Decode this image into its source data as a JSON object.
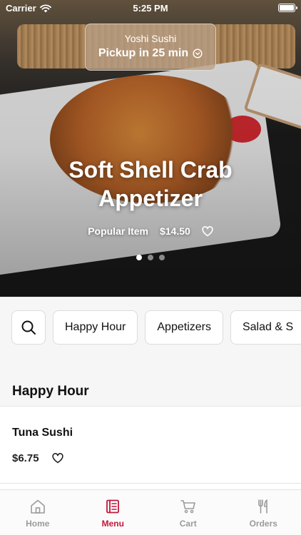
{
  "status_bar": {
    "carrier": "Carrier",
    "time": "5:25 PM"
  },
  "pickup": {
    "store_name": "Yoshi Sushi",
    "eta": "Pickup in 25 min"
  },
  "hero": {
    "title_line1": "Soft Shell Crab",
    "title_line2": "Appetizer",
    "badge": "Popular Item",
    "price": "$14.50",
    "slides_total": 3,
    "active_slide": 1
  },
  "categories": {
    "chips": [
      "Happy Hour",
      "Appetizers",
      "Salad & S"
    ]
  },
  "section": {
    "title": "Happy Hour"
  },
  "menu_item": {
    "name": "Tuna Sushi",
    "price": "$6.75"
  },
  "tabbar": {
    "home": "Home",
    "menu": "Menu",
    "cart": "Cart",
    "orders": "Orders",
    "active_color": "#c1173a",
    "inactive_color": "#9b9b9b"
  }
}
